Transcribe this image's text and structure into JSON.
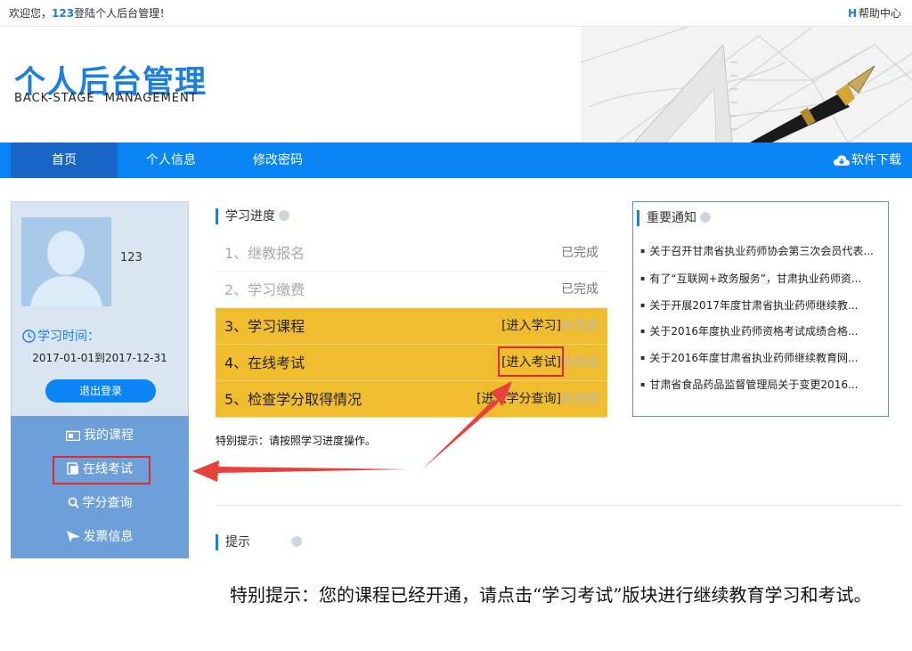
{
  "topbar": {
    "welcome_prefix": "欢迎您，",
    "username": "123",
    "welcome_suffix": "登陆个人后台管理！",
    "help_icon_letter": "H",
    "help": "帮助中心"
  },
  "header": {
    "title_cn": "个人后台管理",
    "title_en": "BACK-STAGE   MANAGEMENT"
  },
  "nav": {
    "items": [
      {
        "label": "首页",
        "active": true
      },
      {
        "label": "个人信息"
      },
      {
        "label": "修改密码"
      }
    ],
    "download": "软件下载"
  },
  "sidebar": {
    "username": "123",
    "study_time_label": "学习时间：",
    "date_range": "2017-01-01到2017-12-31",
    "logout": "退出登录",
    "menu": [
      {
        "label": "我的课程",
        "icon": "video-icon"
      },
      {
        "label": "在线考试",
        "icon": "document-icon"
      },
      {
        "label": "学分查询",
        "icon": "search-icon"
      },
      {
        "label": "发票信息",
        "icon": "send-icon"
      }
    ]
  },
  "progress": {
    "title": "学习进度",
    "steps": [
      {
        "label": "1、继教报名",
        "action": "",
        "status": "已完成"
      },
      {
        "label": "2、学习缴费",
        "action": "",
        "status": "已完成"
      },
      {
        "label": "3、学习课程",
        "action": "[进入学习]",
        "status": "未完成"
      },
      {
        "label": "4、在线考试",
        "action": "[进入考试]",
        "status": "未完成"
      },
      {
        "label": "5、检查学分取得情况",
        "action": "[进入学分查询]",
        "status": "未完成"
      }
    ],
    "tip": "特别提示：请按照学习进度操作。"
  },
  "notices": {
    "title": "重要通知",
    "items": [
      "关于召开甘肃省执业药师协会第三次会员代表...",
      "有了“互联网+政务服务”，甘肃执业药师资...",
      "关于开展2017年度甘肃省执业药师继续教...",
      "关于2016年度执业药师资格考试成绩合格...",
      "关于2016年度甘肃省执业药师继续教育网...",
      "甘肃省食品药品监督管理局关于变更2016..."
    ]
  },
  "hint": {
    "title": "提示",
    "text": "特别提示：您的课程已经开通，请点击“学习考试”版块进行继续教育学习和考试。"
  },
  "colors": {
    "primary": "#0a85f5",
    "step_highlight": "#f0bd2e",
    "annotation": "#e02a2a",
    "sidebar_menu": "#6da0d9"
  }
}
